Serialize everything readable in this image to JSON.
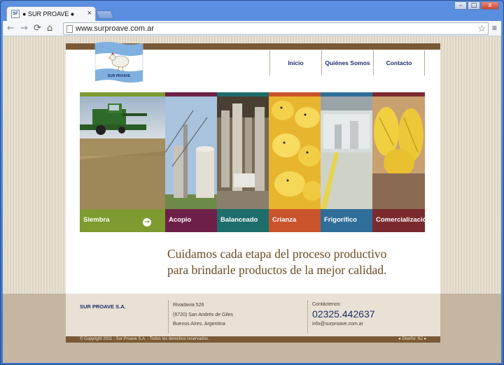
{
  "browser": {
    "tab_title": "● SUR PROAVE ●",
    "tab_close": "×",
    "favicon_text": "SF",
    "url": "www.surproave.com.ar",
    "back_glyph": "←",
    "forward_glyph": "→",
    "reload_glyph": "⟳",
    "home_glyph": "⌂",
    "star_glyph": "☆",
    "menu_glyph": "≡",
    "window_buttons": [
      "–",
      "□",
      "x"
    ]
  },
  "logo": {
    "text": "SUR PROAVE",
    "colors": {
      "flag_blue": "#7fb0e0",
      "flag_white": "#ffffff"
    }
  },
  "nav": {
    "items": [
      "Inicio",
      "Quiénes Somos",
      "Contacto"
    ]
  },
  "panels": [
    {
      "label": "Siembra",
      "color": "#7e9b2f",
      "icon": "arrow-right-icon",
      "arrow": "→"
    },
    {
      "label": "Acopio",
      "color": "#6e1f48"
    },
    {
      "label": "Balanceado",
      "color": "#1d6e6a"
    },
    {
      "label": "Crianza",
      "color": "#c9532a"
    },
    {
      "label": "Frigorífico",
      "color": "#2f6e9a"
    },
    {
      "label": "Comercialización",
      "color": "#7a2a2e"
    }
  ],
  "tagline": {
    "line1": "Cuidamos cada etapa del proceso productivo",
    "line2": "para brindarle productos de la mejor calidad."
  },
  "footer": {
    "company": "SUR PROAVE S.A.",
    "address": [
      "Rivadavia 526",
      "(6720) San Andrés de Giles",
      "Buenos Aires, Argentina"
    ],
    "contact_label": "Contáctenos:",
    "phone": "02325.442637",
    "email": "info@surproave.com.ar",
    "copyright": "© Copyright 2011 - Sur Proave S.A. - Todos los derechos reservados.",
    "credit": "● Diseño: NJ ●"
  }
}
